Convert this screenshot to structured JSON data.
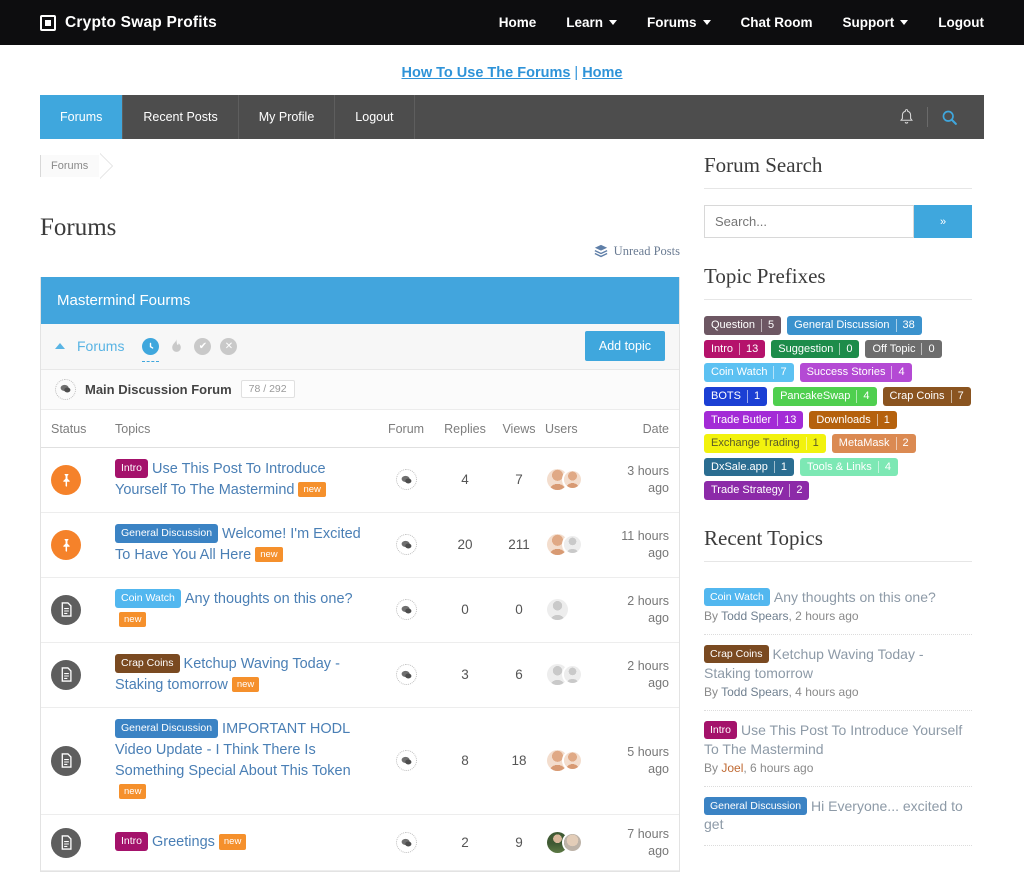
{
  "topbar": {
    "brand": "Crypto Swap Profits",
    "brand_icon": "square-logo-icon",
    "nav": [
      {
        "label": "Home",
        "caret": false
      },
      {
        "label": "Learn",
        "caret": true
      },
      {
        "label": "Forums",
        "caret": true
      },
      {
        "label": "Chat Room",
        "caret": false
      },
      {
        "label": "Support",
        "caret": true
      },
      {
        "label": "Logout",
        "caret": false
      }
    ]
  },
  "sublinks": {
    "first": "How To Use The Forums",
    "separator": "|",
    "second": "Home"
  },
  "tabbar": {
    "tabs": [
      {
        "label": "Forums",
        "active": true
      },
      {
        "label": "Recent Posts",
        "active": false
      },
      {
        "label": "My Profile",
        "active": false
      },
      {
        "label": "Logout",
        "active": false
      }
    ],
    "bell_icon": "bell-icon",
    "search_icon": "search-icon"
  },
  "breadcrumb": {
    "items": [
      "Forums"
    ]
  },
  "page": {
    "title": "Forums",
    "unread_label": "Unread Posts",
    "unread_icon": "layers-icon"
  },
  "card": {
    "header": "Mastermind Fourms",
    "toolbar_label": "Forums",
    "add_topic_label": "Add topic",
    "filter_icons": [
      {
        "name": "clock-icon",
        "glyph": "◔",
        "active": true
      },
      {
        "name": "flame-icon",
        "glyph": "🔥",
        "active": false
      },
      {
        "name": "check-circle-icon",
        "glyph": "✔",
        "active": false
      },
      {
        "name": "x-circle-icon",
        "glyph": "✕",
        "active": false
      }
    ],
    "forum_row": {
      "icon": "comments-icon",
      "name": "Main Discussion Forum",
      "counts": "78 / 292"
    }
  },
  "table": {
    "headers": {
      "status": "Status",
      "topics": "Topics",
      "forum": "Forum",
      "replies": "Replies",
      "views": "Views",
      "users": "Users",
      "date": "Date"
    },
    "rows": [
      {
        "status": "pinned",
        "status_icon": "pin-icon",
        "prefix": {
          "label": "Intro",
          "color": "#a4126b"
        },
        "title": "Use This Post To Introduce Yourself To The Mastermind",
        "new_badge": "new",
        "forum_icon": "comments-icon",
        "replies": "4",
        "views": "7",
        "avatars": [
          "photo-a",
          "photo-a"
        ],
        "date": "3 hours ago"
      },
      {
        "status": "pinned",
        "status_icon": "pin-icon",
        "prefix": {
          "label": "General Discussion",
          "color": "#3b83c4"
        },
        "title": "Welcome! I'm Excited To Have You All Here",
        "new_badge": "new",
        "forum_icon": "comments-icon",
        "replies": "20",
        "views": "211",
        "avatars": [
          "photo-a",
          "silhouette"
        ],
        "date": "11 hours ago"
      },
      {
        "status": "doc",
        "status_icon": "document-icon",
        "prefix": {
          "label": "Coin Watch",
          "color": "#52b7ef"
        },
        "title": "Any thoughts on this one?",
        "new_badge": "new",
        "forum_icon": "comments-icon",
        "replies": "0",
        "views": "0",
        "avatars": [
          "silhouette"
        ],
        "date": "2 hours ago"
      },
      {
        "status": "doc",
        "status_icon": "document-icon",
        "prefix": {
          "label": "Crap Coins",
          "color": "#7a4a21"
        },
        "title": "Ketchup Waving Today - Staking tomorrow",
        "new_badge": "new",
        "forum_icon": "comments-icon",
        "replies": "3",
        "views": "6",
        "avatars": [
          "silhouette",
          "silhouette"
        ],
        "date": "2 hours ago"
      },
      {
        "status": "doc",
        "status_icon": "document-icon",
        "prefix": {
          "label": "General Discussion",
          "color": "#3b83c4"
        },
        "title": "IMPORTANT HODL Video Update - I Think There Is Something Special About This Token",
        "new_badge": "new",
        "forum_icon": "comments-icon",
        "replies": "8",
        "views": "18",
        "avatars": [
          "photo-a",
          "photo-a"
        ],
        "date": "5 hours ago"
      },
      {
        "status": "doc",
        "status_icon": "document-icon",
        "prefix": {
          "label": "Intro",
          "color": "#a4126b"
        },
        "title": "Greetings",
        "new_badge": "new",
        "forum_icon": "comments-icon",
        "replies": "2",
        "views": "9",
        "avatars": [
          "photo-b",
          "photo-c"
        ],
        "date": "7 hours ago"
      }
    ]
  },
  "sidebar": {
    "search": {
      "title": "Forum Search",
      "placeholder": "Search...",
      "value": "",
      "button_glyph": "»"
    },
    "prefixes": {
      "title": "Topic Prefixes",
      "tags": [
        {
          "label": "Question",
          "count": "5",
          "color": "#6d5763"
        },
        {
          "label": "General Discussion",
          "count": "38",
          "color": "#3b92cd"
        },
        {
          "label": "Intro",
          "count": "13",
          "color": "#b5126b"
        },
        {
          "label": "Suggestion",
          "count": "0",
          "color": "#1d8c4a"
        },
        {
          "label": "Off Topic",
          "count": "0",
          "color": "#6d6d6d"
        },
        {
          "label": "Coin Watch",
          "count": "7",
          "color": "#5cc1f2"
        },
        {
          "label": "Success Stories",
          "count": "4",
          "color": "#b44ad4"
        },
        {
          "label": "BOTS",
          "count": "1",
          "color": "#1b3fd4"
        },
        {
          "label": "PancakeSwap",
          "count": "4",
          "color": "#4fcf4f"
        },
        {
          "label": "Crap Coins",
          "count": "7",
          "color": "#8a5420"
        },
        {
          "label": "Trade Butler",
          "count": "13",
          "color": "#a32ad6"
        },
        {
          "label": "Downloads",
          "count": "1",
          "color": "#b5610d"
        },
        {
          "label": "Exchange Trading",
          "count": "1",
          "color": "#f2f20d"
        },
        {
          "label": "MetaMask",
          "count": "2",
          "color": "#db8a52"
        },
        {
          "label": "DxSale.app",
          "count": "1",
          "color": "#2a6d91"
        },
        {
          "label": "Tools & Links",
          "count": "4",
          "color": "#7de8b4"
        },
        {
          "label": "Trade Strategy",
          "count": "2",
          "color": "#8c2aa8"
        }
      ]
    },
    "recent": {
      "title": "Recent Topics",
      "items": [
        {
          "prefix": {
            "label": "Coin Watch",
            "color": "#52b7ef"
          },
          "title": "Any thoughts on this one?",
          "by": "By",
          "author": "Todd Spears",
          "time": ", 2 hours ago"
        },
        {
          "prefix": {
            "label": "Crap Coins",
            "color": "#7a4a21"
          },
          "title": "Ketchup Waving Today - Staking tomorrow",
          "by": "By",
          "author": "Todd Spears",
          "time": ", 4 hours ago"
        },
        {
          "prefix": {
            "label": "Intro",
            "color": "#a4126b"
          },
          "title": "Use This Post To Introduce Yourself To The Mastermind",
          "by": "By",
          "author": "Joel",
          "time": ", 6 hours ago"
        },
        {
          "prefix": {
            "label": "General Discussion",
            "color": "#3b83c4"
          },
          "title": "Hi Everyone... excited to get",
          "by": "",
          "author": "",
          "time": ""
        }
      ]
    }
  },
  "theme": {
    "accent": "#3fa7dd",
    "header_bg": "#0d0d0f",
    "pin_orange": "#f5822a",
    "link_blue": "#4a7fb5"
  }
}
